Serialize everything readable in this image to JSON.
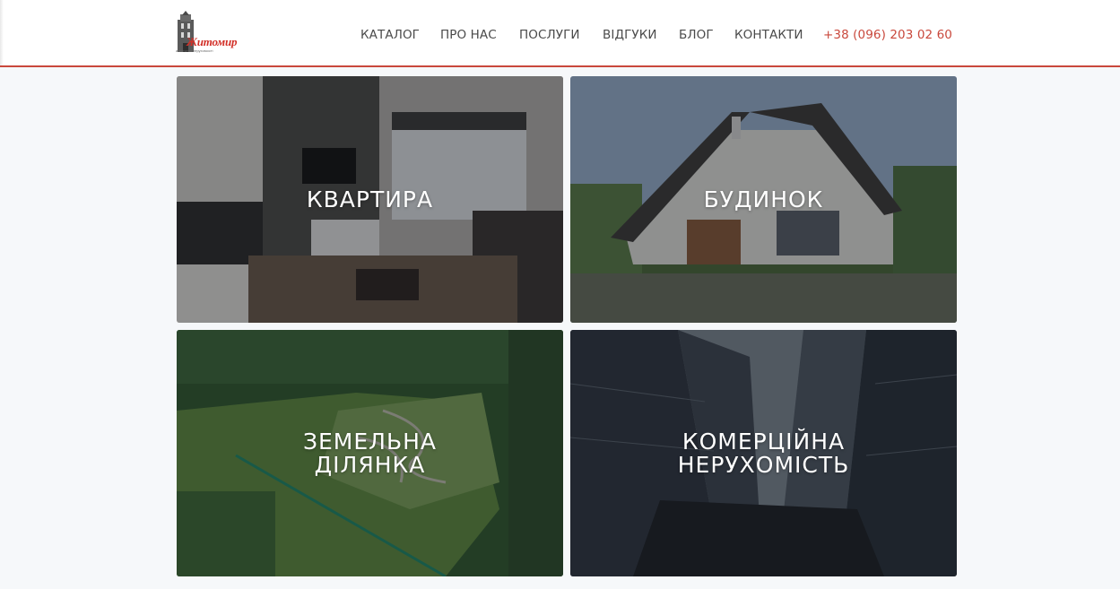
{
  "header": {
    "logo": {
      "name": "Житомир",
      "subtitle": "агентство нерухомості",
      "icon": "tower-icon"
    },
    "nav": [
      {
        "label": "КАТАЛОГ"
      },
      {
        "label": "ПРО НАС"
      },
      {
        "label": "ПОСЛУГИ"
      },
      {
        "label": "ВІДГУКИ"
      },
      {
        "label": "БЛОГ"
      },
      {
        "label": "КОНТАКТИ"
      }
    ],
    "phone": "+38 (096) 203 02 60"
  },
  "categories": [
    {
      "line1": "КВАРТИРА",
      "line2": ""
    },
    {
      "line1": "БУДИНОК",
      "line2": ""
    },
    {
      "line1": "ЗЕМЕЛЬНА",
      "line2": "ДІЛЯНКА"
    },
    {
      "line1": "КОМЕРЦІЙНА",
      "line2": "НЕРУХОМІСТЬ"
    }
  ],
  "colors": {
    "accent": "#c9483c",
    "nav_text": "#4a4a4a",
    "background": "#f6f8fa"
  }
}
